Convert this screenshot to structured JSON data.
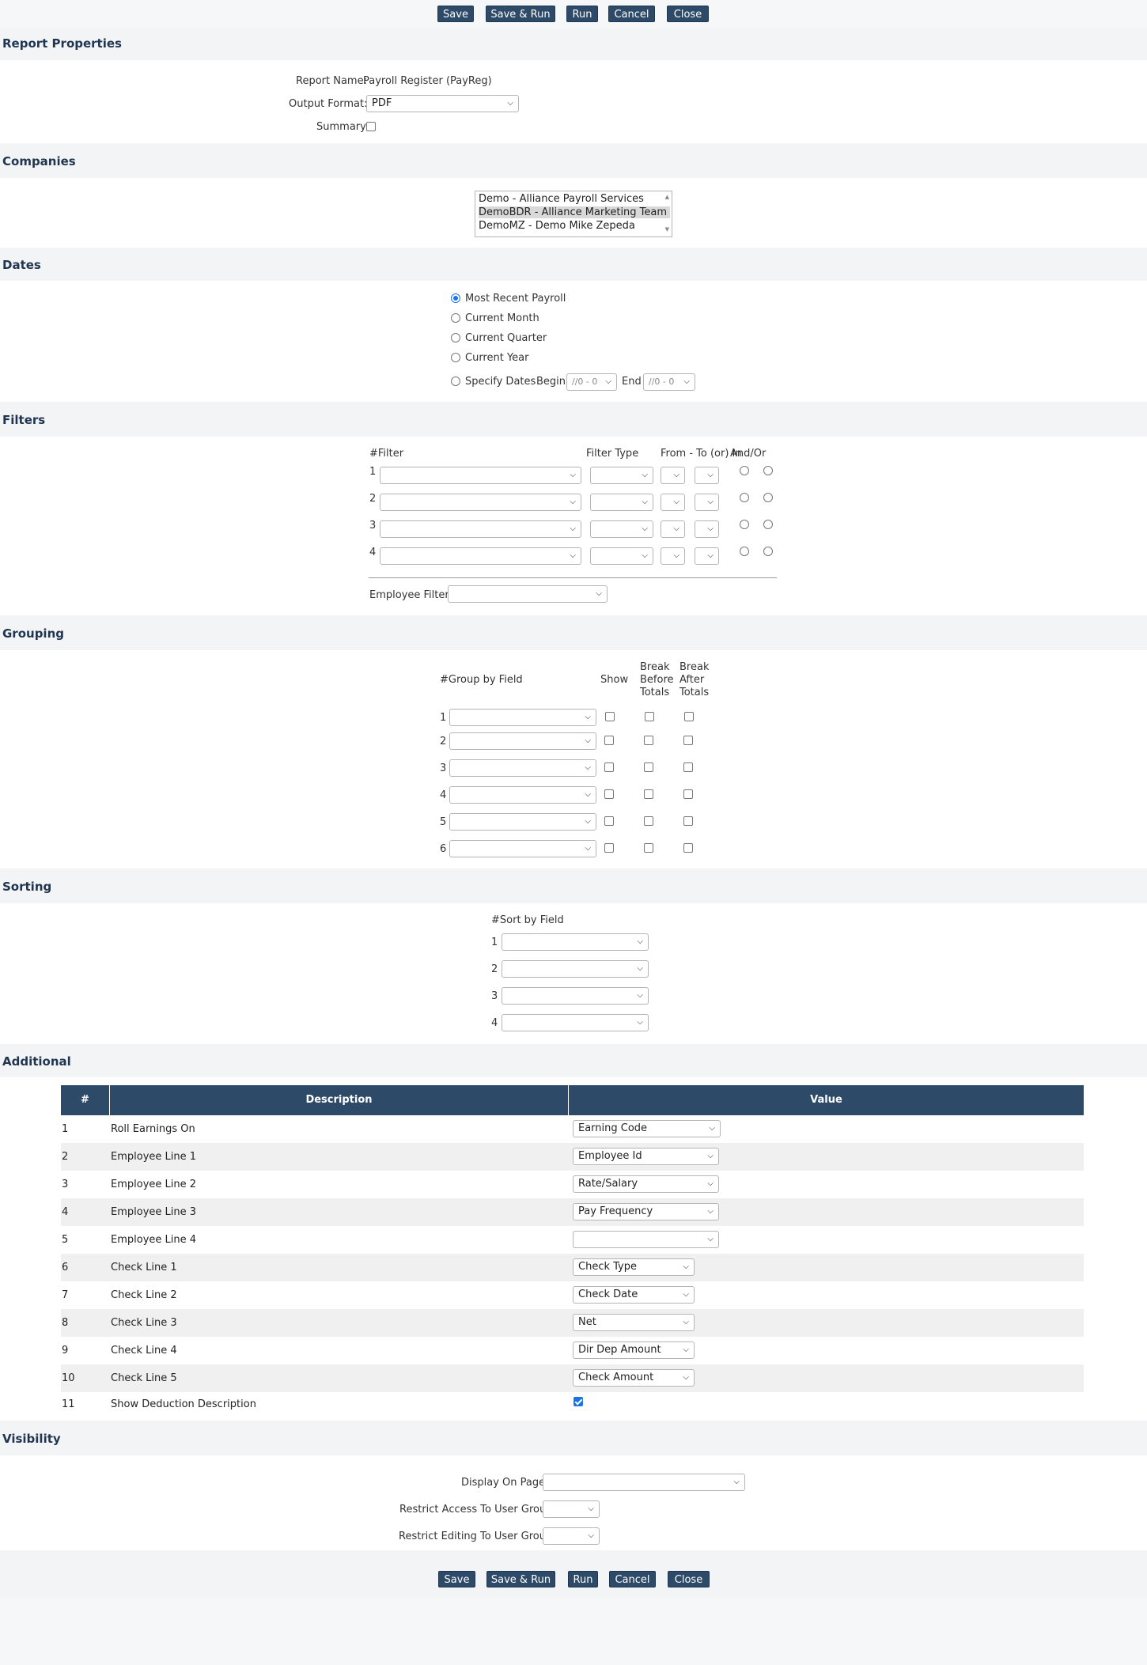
{
  "toolbar": {
    "save": "Save",
    "save_run": "Save & Run",
    "run": "Run",
    "cancel": "Cancel",
    "close": "Close"
  },
  "report_properties": {
    "title": "Report Properties",
    "report_name_label": "Report Name:",
    "report_name_value": "Payroll Register (PayReg)",
    "output_format_label": "Output Format:",
    "output_format_value": "PDF",
    "summary_label": "Summary",
    "summary_checked": false
  },
  "companies": {
    "title": "Companies",
    "items": [
      {
        "label": "Demo - Alliance Payroll Services",
        "selected": false
      },
      {
        "label": "DemoBDR - Alliance Marketing Team",
        "selected": true
      },
      {
        "label": "DemoMZ - Demo Mike Zepeda",
        "selected": false
      }
    ]
  },
  "dates": {
    "title": "Dates",
    "options": [
      "Most Recent Payroll",
      "Current Month",
      "Current Quarter",
      "Current Year",
      "Specify Dates"
    ],
    "selected": "Most Recent Payroll",
    "begin_label": "Begin",
    "begin_value": "//0 - 0",
    "end_label": "End",
    "end_value": "//0 - 0"
  },
  "filters": {
    "title": "Filters",
    "col_num_filter": "#Filter",
    "col_filter_type": "Filter Type",
    "col_from_to": "From - To (or) In",
    "col_and_or": "And/Or",
    "rows": [
      "1",
      "2",
      "3",
      "4"
    ],
    "employee_filter_label": "Employee Filter",
    "employee_filter_value": ""
  },
  "grouping": {
    "title": "Grouping",
    "col_group": "#Group by Field",
    "col_show": "Show",
    "col_break_before": [
      "Break",
      "Before",
      "Totals"
    ],
    "col_break_after": [
      "Break",
      "After",
      "Totals"
    ],
    "rows": [
      "1",
      "2",
      "3",
      "4",
      "5",
      "6"
    ]
  },
  "sorting": {
    "title": "Sorting",
    "col_sort": "#Sort by Field",
    "rows": [
      "1",
      "2",
      "3",
      "4"
    ]
  },
  "additional": {
    "title": "Additional",
    "headers": {
      "num": "#",
      "description": "Description",
      "value": "Value"
    },
    "rows": [
      {
        "num": "1",
        "description": "Roll Earnings On",
        "value": "Earning Code",
        "type": "select-wide"
      },
      {
        "num": "2",
        "description": "Employee Line 1",
        "value": "Employee Id",
        "type": "select-wide"
      },
      {
        "num": "3",
        "description": "Employee Line 2",
        "value": "Rate/Salary",
        "type": "select-wide"
      },
      {
        "num": "4",
        "description": "Employee Line 3",
        "value": "Pay Frequency",
        "type": "select-wide"
      },
      {
        "num": "5",
        "description": "Employee Line 4",
        "value": "",
        "type": "select-wide"
      },
      {
        "num": "6",
        "description": "Check Line 1",
        "value": "Check Type",
        "type": "select"
      },
      {
        "num": "7",
        "description": "Check Line 2",
        "value": "Check Date",
        "type": "select"
      },
      {
        "num": "8",
        "description": "Check Line 3",
        "value": "Net",
        "type": "select"
      },
      {
        "num": "9",
        "description": "Check Line 4",
        "value": "Dir Dep Amount",
        "type": "select"
      },
      {
        "num": "10",
        "description": "Check Line 5",
        "value": "Check Amount",
        "type": "select"
      },
      {
        "num": "11",
        "description": "Show Deduction Description",
        "value": true,
        "type": "checkbox"
      }
    ]
  },
  "visibility": {
    "title": "Visibility",
    "display_on_page_label": "Display On Page",
    "display_on_page_value": "",
    "restrict_access_label": "Restrict Access To User Group",
    "restrict_access_value": "",
    "restrict_editing_label": "Restrict Editing To User Group",
    "restrict_editing_value": ""
  },
  "colors": {
    "button_bg": "#2e4a69",
    "header_bg": "#2e4a69",
    "section_title": "#1f3550",
    "accent": "#1a73e8"
  }
}
